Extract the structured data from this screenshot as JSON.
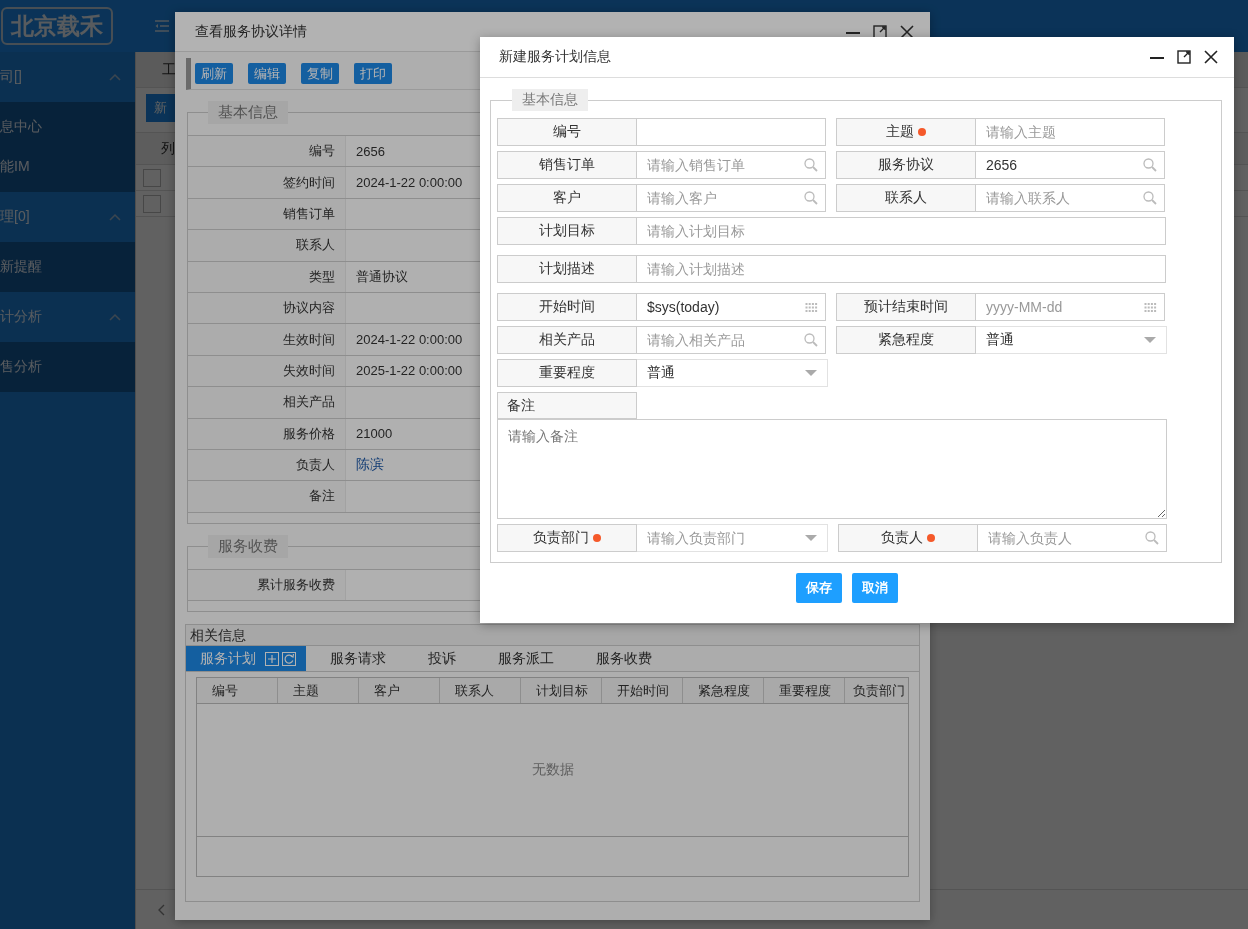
{
  "app": {
    "logo": "北京载禾",
    "menu_groups": [
      {
        "title": "司[]",
        "expanded": true,
        "items": [
          "息中心",
          "能IM"
        ]
      },
      {
        "title": "理[0]",
        "expanded": true,
        "items": [
          "新提醒"
        ]
      },
      {
        "title": "计分析",
        "expanded": true,
        "items": [
          "售分析"
        ]
      }
    ],
    "tab": "工",
    "new_button": "新",
    "table": {
      "columns": [
        "列"
      ],
      "rows": [
        {
          "checked": false
        },
        {
          "checked": false
        }
      ]
    }
  },
  "agreement_dialog": {
    "title": "查看服务协议详情",
    "toolbar": [
      "刷新",
      "编辑",
      "复制",
      "打印"
    ],
    "sections": [
      {
        "legend": "基本信息",
        "fields": [
          {
            "label": "编号",
            "value": "2656"
          },
          {
            "label": "签约时间",
            "value": "2024-1-22 0:00:00"
          },
          {
            "label": "销售订单"
          },
          {
            "label": "联系人"
          },
          {
            "label": "类型",
            "value": "普通协议"
          },
          {
            "label": "协议内容"
          },
          {
            "label": "生效时间",
            "value": "2024-1-22 0:00:00"
          },
          {
            "label": "失效时间",
            "value": "2025-1-22 0:00:00"
          },
          {
            "label": "相关产品"
          },
          {
            "label": "服务价格",
            "value": "21000"
          },
          {
            "label": "负责人",
            "value": "陈滨",
            "kind": "link"
          },
          {
            "label": "备注"
          }
        ]
      },
      {
        "legend": "服务收费",
        "fields": [
          {
            "label": "累计服务收费"
          }
        ]
      }
    ],
    "related": {
      "title": "相关信息",
      "tabs": [
        {
          "label": "服务计划",
          "selected": true
        },
        {
          "label": "服务请求",
          "selected": false
        },
        {
          "label": "投诉",
          "selected": false
        },
        {
          "label": "服务派工",
          "selected": false
        },
        {
          "label": "服务收费",
          "selected": false
        }
      ],
      "columns": [
        "编号",
        "主题",
        "客户",
        "联系人",
        "计划目标",
        "开始时间",
        "紧急程度",
        "重要程度",
        "负责部门"
      ],
      "empty_text": "无数据"
    }
  },
  "plan_dialog": {
    "title": "新建服务计划信息",
    "legend": "基本信息",
    "rows": [
      [
        {
          "label": "编号",
          "kind": "text"
        },
        {
          "label": "主题",
          "kind": "text",
          "required": true,
          "placeholder": "请输入主题"
        }
      ],
      [
        {
          "label": "销售订单",
          "kind": "lookup",
          "placeholder": "请输入销售订单"
        },
        {
          "label": "服务协议",
          "kind": "lookup",
          "value": "2656"
        }
      ],
      [
        {
          "label": "客户",
          "kind": "lookup",
          "placeholder": "请输入客户"
        },
        {
          "label": "联系人",
          "kind": "lookup",
          "placeholder": "请输入联系人"
        }
      ],
      [
        {
          "label": "计划目标",
          "kind": "wide",
          "placeholder": "请输入计划目标"
        }
      ],
      [
        {
          "label": "计划描述",
          "kind": "wide",
          "placeholder": "请输入计划描述"
        }
      ],
      [
        {
          "label": "开始时间",
          "kind": "date",
          "value": "$sys(today)"
        },
        {
          "label": "预计结束时间",
          "kind": "date",
          "placeholder": "yyyy-MM-dd"
        }
      ],
      [
        {
          "label": "相关产品",
          "kind": "lookup",
          "placeholder": "请输入相关产品"
        },
        {
          "label": "紧急程度",
          "kind": "select",
          "value": "普通"
        }
      ],
      [
        {
          "label": "重要程度",
          "kind": "select",
          "value": "普通"
        }
      ],
      [
        {
          "label": "备注",
          "kind": "textarea",
          "placeholder": "请输入备注"
        }
      ],
      [
        {
          "label": "负责部门",
          "kind": "select",
          "required": true,
          "placeholder": "请输入负责部门"
        },
        {
          "label": "负责人",
          "kind": "lookup",
          "required": true,
          "placeholder": "请输入负责人"
        }
      ]
    ],
    "buttons": [
      "保存",
      "取消"
    ]
  }
}
